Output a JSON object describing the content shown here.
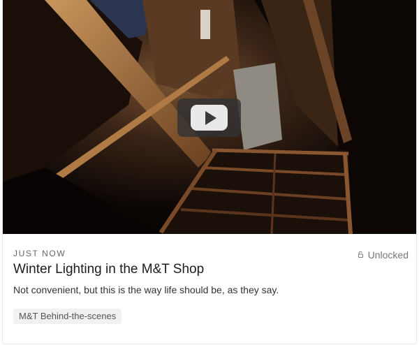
{
  "post": {
    "timestamp": "JUST NOW",
    "access_label": "Unlocked",
    "title": "Winter Lighting in the M&T Shop",
    "description": "Not convenient, but this is the way life should be, as they say.",
    "tags": [
      "M&T Behind-the-scenes"
    ]
  },
  "video": {
    "thumbnail_icon": "play-icon",
    "state": "paused"
  },
  "colors": {
    "title": "#1c1c1c",
    "muted": "#666666",
    "tag_bg": "#f1f1f1"
  }
}
